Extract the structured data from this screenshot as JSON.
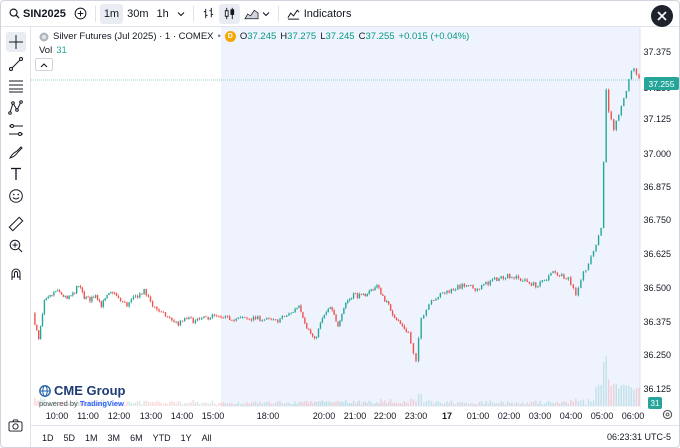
{
  "toolbar": {
    "symbol": "SIN2025",
    "intervals": [
      "1m",
      "30m",
      "1h"
    ],
    "active_interval": "1m",
    "indicators_label": "Indicators"
  },
  "legend": {
    "title": "Silver Futures (Jul 2025) · 1 · COMEX",
    "badge": "D",
    "open_label": "O",
    "open": "37.245",
    "high_label": "H",
    "high": "37.275",
    "low_label": "L",
    "low": "37.245",
    "close_label": "C",
    "close": "37.255",
    "change": "+0.015 (+0.04%)",
    "vol_label": "Vol",
    "vol_value": "31"
  },
  "price_axis": [
    "37.375",
    "37.250",
    "37.125",
    "37.000",
    "36.875",
    "36.750",
    "36.625",
    "36.500",
    "36.375",
    "36.250",
    "36.125"
  ],
  "last_price_label": "37.255",
  "volume_badge": "31",
  "time_axis": [
    "10:00",
    "11:00",
    "12:00",
    "13:00",
    "14:00",
    "15:00",
    "18:00",
    "20:00",
    "21:00",
    "22:00",
    "23:00",
    "17",
    "01:00",
    "02:00",
    "03:00",
    "04:00",
    "05:00",
    "06:00"
  ],
  "branding": {
    "name": "CME Group",
    "powered": "powered by",
    "tv": "TradingView"
  },
  "ranges": [
    "1D",
    "5D",
    "1M",
    "3M",
    "6M",
    "YTD",
    "1Y",
    "All"
  ],
  "clock": "06:23:31 UTC-5",
  "colors": {
    "up": "#26a69a",
    "down": "#ef5350",
    "session_bg": "#eef3fd"
  },
  "chart_data": {
    "type": "candlestick",
    "ylim": [
      36.1,
      37.42
    ],
    "series": [
      {
        "x": "09:30",
        "y": 36.4
      },
      {
        "x": "09:40",
        "y": 36.3
      },
      {
        "x": "09:50",
        "y": 36.44
      },
      {
        "x": "10:00",
        "y": 36.46
      },
      {
        "x": "10:10",
        "y": 36.48
      },
      {
        "x": "10:20",
        "y": 36.47
      },
      {
        "x": "10:30",
        "y": 36.45
      },
      {
        "x": "10:40",
        "y": 36.47
      },
      {
        "x": "10:50",
        "y": 36.5
      },
      {
        "x": "11:00",
        "y": 36.46
      },
      {
        "x": "11:10",
        "y": 36.45
      },
      {
        "x": "11:20",
        "y": 36.47
      },
      {
        "x": "11:30",
        "y": 36.43
      },
      {
        "x": "11:40",
        "y": 36.46
      },
      {
        "x": "11:50",
        "y": 36.48
      },
      {
        "x": "12:00",
        "y": 36.45
      },
      {
        "x": "12:15",
        "y": 36.43
      },
      {
        "x": "12:30",
        "y": 36.46
      },
      {
        "x": "12:45",
        "y": 36.48
      },
      {
        "x": "13:00",
        "y": 36.43
      },
      {
        "x": "13:15",
        "y": 36.4
      },
      {
        "x": "13:30",
        "y": 36.38
      },
      {
        "x": "13:45",
        "y": 36.36
      },
      {
        "x": "14:00",
        "y": 36.38
      },
      {
        "x": "14:15",
        "y": 36.37
      },
      {
        "x": "14:30",
        "y": 36.38
      },
      {
        "x": "14:45",
        "y": 36.39
      },
      {
        "x": "15:00",
        "y": 36.38
      },
      {
        "x": "18:00",
        "y": 36.38
      },
      {
        "x": "18:30",
        "y": 36.37
      },
      {
        "x": "19:00",
        "y": 36.4
      },
      {
        "x": "19:15",
        "y": 36.43
      },
      {
        "x": "19:30",
        "y": 36.35
      },
      {
        "x": "19:45",
        "y": 36.3
      },
      {
        "x": "20:00",
        "y": 36.38
      },
      {
        "x": "20:15",
        "y": 36.42
      },
      {
        "x": "20:30",
        "y": 36.36
      },
      {
        "x": "20:45",
        "y": 36.44
      },
      {
        "x": "21:00",
        "y": 36.47
      },
      {
        "x": "21:15",
        "y": 36.46
      },
      {
        "x": "21:30",
        "y": 36.48
      },
      {
        "x": "21:45",
        "y": 36.5
      },
      {
        "x": "22:00",
        "y": 36.45
      },
      {
        "x": "22:15",
        "y": 36.4
      },
      {
        "x": "22:30",
        "y": 36.36
      },
      {
        "x": "22:45",
        "y": 36.33
      },
      {
        "x": "22:55",
        "y": 36.25
      },
      {
        "x": "23:00",
        "y": 36.22
      },
      {
        "x": "23:10",
        "y": 36.38
      },
      {
        "x": "23:20",
        "y": 36.42
      },
      {
        "x": "23:30",
        "y": 36.45
      },
      {
        "x": "00:00",
        "y": 36.48
      },
      {
        "x": "00:30",
        "y": 36.5
      },
      {
        "x": "01:00",
        "y": 36.49
      },
      {
        "x": "01:30",
        "y": 36.52
      },
      {
        "x": "02:00",
        "y": 36.54
      },
      {
        "x": "02:30",
        "y": 36.52
      },
      {
        "x": "03:00",
        "y": 36.5
      },
      {
        "x": "03:30",
        "y": 36.55
      },
      {
        "x": "04:00",
        "y": 36.53
      },
      {
        "x": "04:15",
        "y": 36.47
      },
      {
        "x": "04:30",
        "y": 36.55
      },
      {
        "x": "04:45",
        "y": 36.6
      },
      {
        "x": "05:00",
        "y": 36.68
      },
      {
        "x": "05:05",
        "y": 36.72
      },
      {
        "x": "05:10",
        "y": 36.96
      },
      {
        "x": "05:15",
        "y": 37.22
      },
      {
        "x": "05:20",
        "y": 37.14
      },
      {
        "x": "05:30",
        "y": 37.08
      },
      {
        "x": "05:40",
        "y": 37.12
      },
      {
        "x": "05:50",
        "y": 37.18
      },
      {
        "x": "06:00",
        "y": 37.26
      },
      {
        "x": "06:10",
        "y": 37.3
      },
      {
        "x": "06:20",
        "y": 37.255
      }
    ]
  }
}
